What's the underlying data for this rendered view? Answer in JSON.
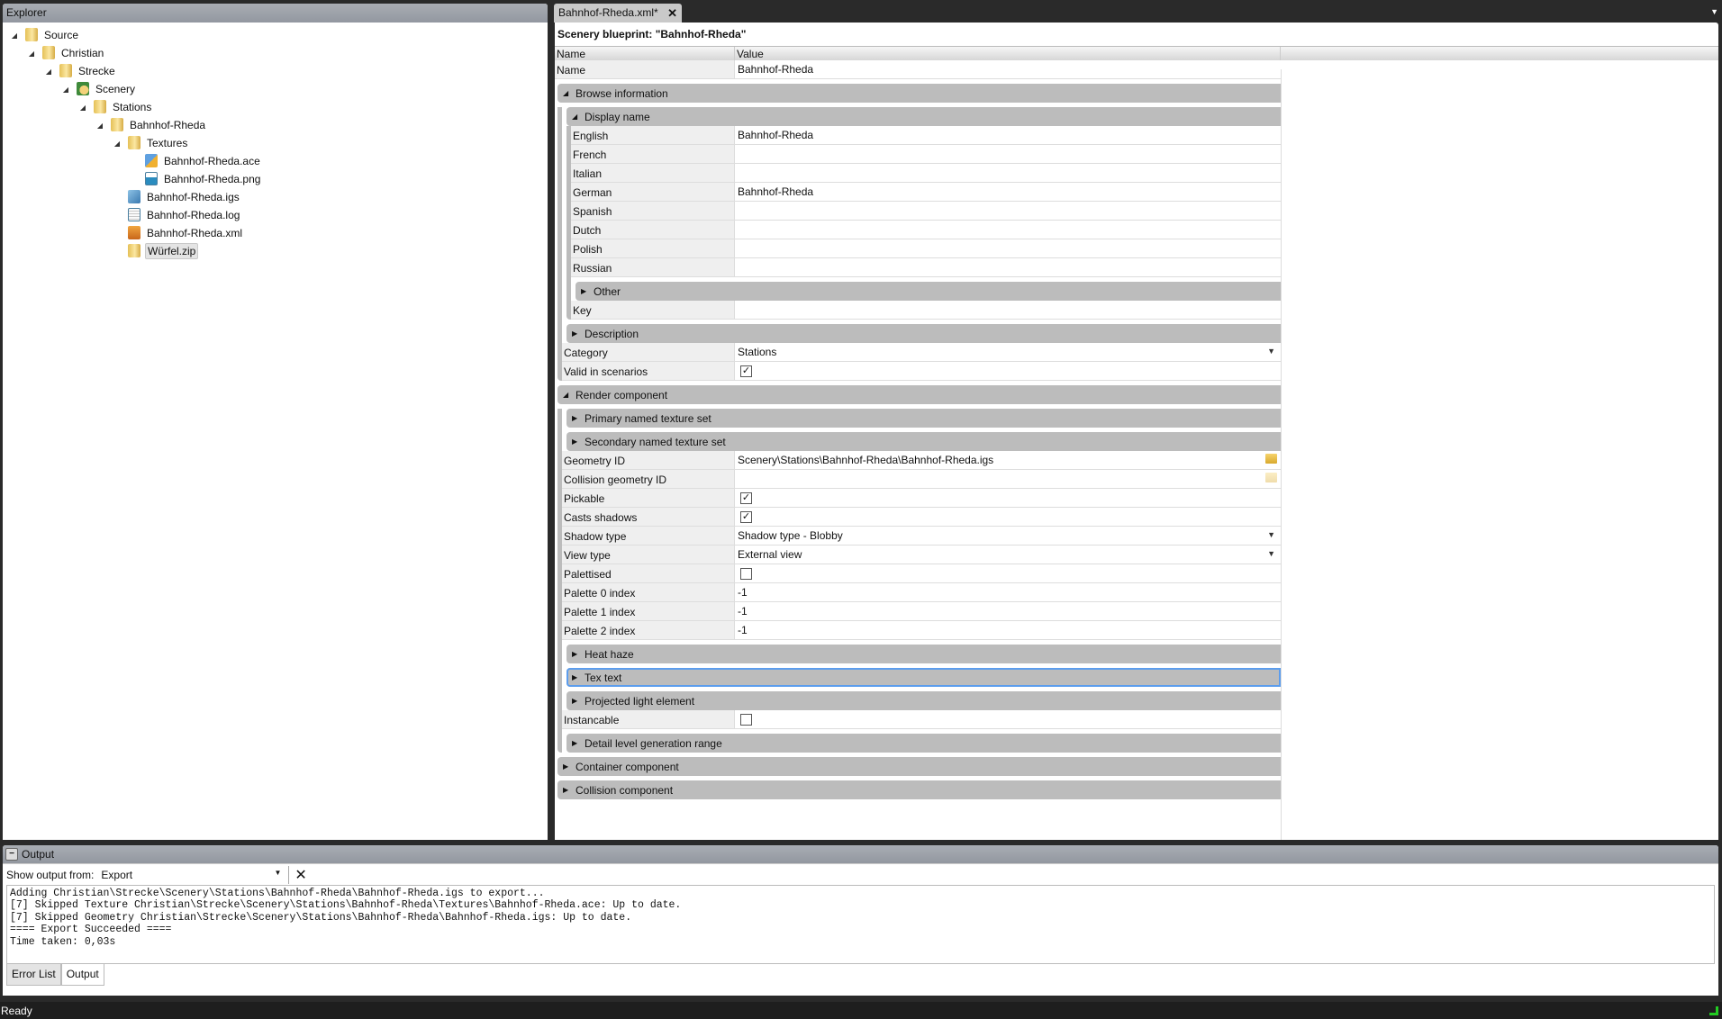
{
  "explorer": {
    "title": "Explorer",
    "items": [
      {
        "label": "Source",
        "depth": 0,
        "icon": "folder-icon",
        "expanded": true
      },
      {
        "label": "Christian",
        "depth": 1,
        "icon": "folder-icon",
        "expanded": true
      },
      {
        "label": "Strecke",
        "depth": 2,
        "icon": "folder-icon",
        "expanded": true
      },
      {
        "label": "Scenery",
        "depth": 3,
        "icon": "scenery-icon",
        "expanded": true
      },
      {
        "label": "Stations",
        "depth": 4,
        "icon": "folder-icon",
        "expanded": true
      },
      {
        "label": "Bahnhof-Rheda",
        "depth": 5,
        "icon": "folder-icon",
        "expanded": true
      },
      {
        "label": "Textures",
        "depth": 6,
        "icon": "folder-icon",
        "expanded": true
      },
      {
        "label": "Bahnhof-Rheda.ace",
        "depth": 7,
        "icon": "texture-file-icon"
      },
      {
        "label": "Bahnhof-Rheda.png",
        "depth": 7,
        "icon": "image-file-icon"
      },
      {
        "label": "Bahnhof-Rheda.igs",
        "depth": 6,
        "icon": "geometry-file-icon"
      },
      {
        "label": "Bahnhof-Rheda.log",
        "depth": 6,
        "icon": "text-file-icon"
      },
      {
        "label": "Bahnhof-Rheda.xml",
        "depth": 6,
        "icon": "blueprint-file-icon"
      },
      {
        "label": "Würfel.zip",
        "depth": 6,
        "icon": "zip-folder-icon",
        "selected": true
      }
    ]
  },
  "document": {
    "tab_label": "Bahnhof-Rheda.xml*",
    "close_icon": "close-icon",
    "title": "Scenery blueprint: \"Bahnhof-Rheda\"",
    "columns": {
      "name": "Name",
      "value": "Value"
    },
    "properties": [
      {
        "type": "prop",
        "name": "Name",
        "value": "Bahnhof-Rheda",
        "kind": "text"
      },
      {
        "type": "group",
        "name": "Browse information",
        "expanded": true,
        "children": [
          {
            "type": "group",
            "name": "Display name",
            "expanded": true,
            "children": [
              {
                "type": "prop",
                "name": "English",
                "value": "Bahnhof-Rheda",
                "kind": "text"
              },
              {
                "type": "prop",
                "name": "French",
                "value": "",
                "kind": "text"
              },
              {
                "type": "prop",
                "name": "Italian",
                "value": "",
                "kind": "text"
              },
              {
                "type": "prop",
                "name": "German",
                "value": "Bahnhof-Rheda",
                "kind": "text"
              },
              {
                "type": "prop",
                "name": "Spanish",
                "value": "",
                "kind": "text"
              },
              {
                "type": "prop",
                "name": "Dutch",
                "value": "",
                "kind": "text"
              },
              {
                "type": "prop",
                "name": "Polish",
                "value": "",
                "kind": "text"
              },
              {
                "type": "prop",
                "name": "Russian",
                "value": "",
                "kind": "text"
              },
              {
                "type": "group",
                "name": "Other",
                "expanded": false,
                "children": []
              },
              {
                "type": "prop",
                "name": "Key",
                "value": "",
                "kind": "text"
              }
            ]
          },
          {
            "type": "group",
            "name": "Description",
            "expanded": false,
            "children": []
          },
          {
            "type": "prop",
            "name": "Category",
            "value": "Stations",
            "kind": "dropdown"
          },
          {
            "type": "prop",
            "name": "Valid in scenarios",
            "value": true,
            "kind": "checkbox"
          }
        ]
      },
      {
        "type": "group",
        "name": "Render component",
        "expanded": true,
        "children": [
          {
            "type": "group",
            "name": "Primary named texture set",
            "expanded": false,
            "children": []
          },
          {
            "type": "group",
            "name": "Secondary named texture set",
            "expanded": false,
            "children": []
          },
          {
            "type": "prop",
            "name": "Geometry ID",
            "value": "Scenery\\Stations\\Bahnhof-Rheda\\Bahnhof-Rheda.igs",
            "kind": "file"
          },
          {
            "type": "prop",
            "name": "Collision geometry ID",
            "value": "",
            "kind": "file"
          },
          {
            "type": "prop",
            "name": "Pickable",
            "value": true,
            "kind": "checkbox"
          },
          {
            "type": "prop",
            "name": "Casts shadows",
            "value": true,
            "kind": "checkbox"
          },
          {
            "type": "prop",
            "name": "Shadow type",
            "value": "Shadow type - Blobby",
            "kind": "dropdown"
          },
          {
            "type": "prop",
            "name": "View type",
            "value": "External view",
            "kind": "dropdown"
          },
          {
            "type": "prop",
            "name": "Palettised",
            "value": false,
            "kind": "checkbox"
          },
          {
            "type": "prop",
            "name": "Palette 0 index",
            "value": "-1",
            "kind": "text"
          },
          {
            "type": "prop",
            "name": "Palette 1 index",
            "value": "-1",
            "kind": "text"
          },
          {
            "type": "prop",
            "name": "Palette 2 index",
            "value": "-1",
            "kind": "text"
          },
          {
            "type": "group",
            "name": "Heat haze",
            "expanded": false,
            "children": []
          },
          {
            "type": "group",
            "name": "Tex text",
            "expanded": false,
            "focused": true,
            "children": []
          },
          {
            "type": "group",
            "name": "Projected light element",
            "expanded": false,
            "children": []
          },
          {
            "type": "prop",
            "name": "Instancable",
            "value": false,
            "kind": "checkbox"
          },
          {
            "type": "group",
            "name": "Detail level generation range",
            "expanded": false,
            "children": []
          }
        ]
      },
      {
        "type": "group",
        "name": "Container component",
        "expanded": false,
        "children": []
      },
      {
        "type": "group",
        "name": "Collision component",
        "expanded": false,
        "children": []
      }
    ]
  },
  "output": {
    "title": "Output",
    "show_from_label": "Show output from:",
    "source": "Export",
    "lines": [
      "Adding Christian\\Strecke\\Scenery\\Stations\\Bahnhof-Rheda\\Bahnhof-Rheda.igs to export...",
      "[7] Skipped Texture Christian\\Strecke\\Scenery\\Stations\\Bahnhof-Rheda\\Textures\\Bahnhof-Rheda.ace: Up to date.",
      "[7] Skipped Geometry Christian\\Strecke\\Scenery\\Stations\\Bahnhof-Rheda\\Bahnhof-Rheda.igs: Up to date.",
      "==== Export Succeeded ====",
      "Time taken: 0,03s"
    ],
    "tabs": [
      "Error List",
      "Output"
    ],
    "active_tab": "Output"
  },
  "status": {
    "text": "Ready"
  }
}
